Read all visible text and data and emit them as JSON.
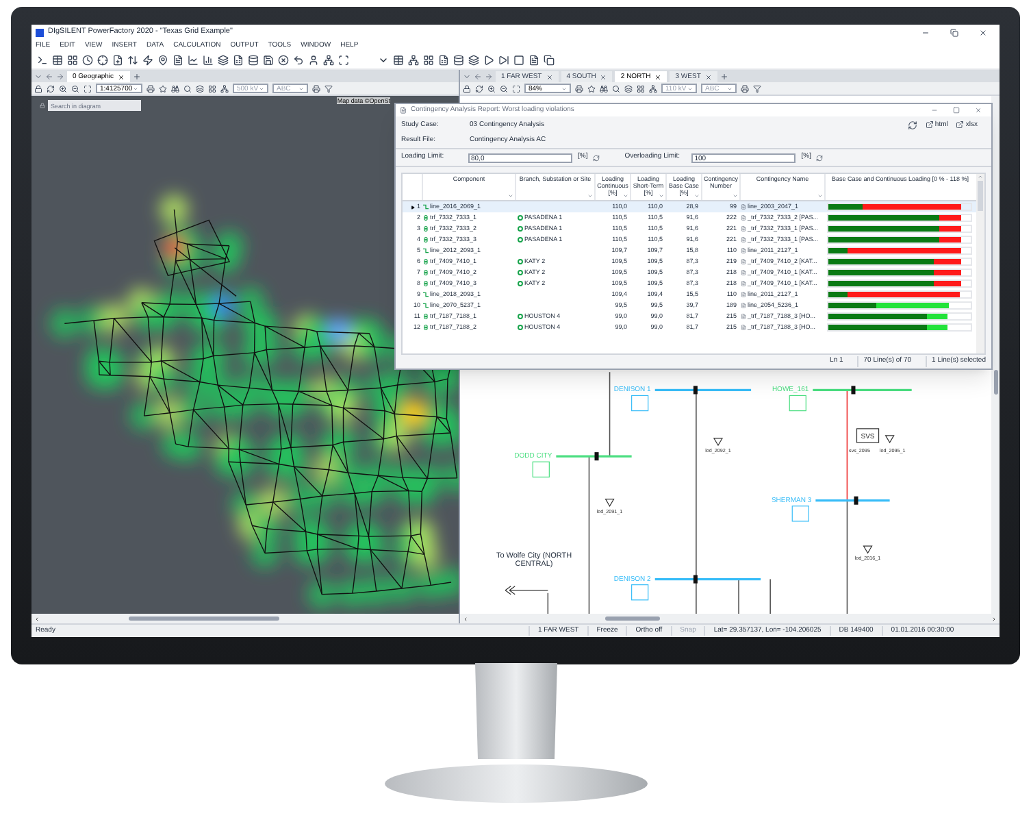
{
  "window": {
    "title": "DIgSILENT PowerFactory 2020 - \"Texas Grid Example\""
  },
  "menu": [
    "FILE",
    "EDIT",
    "VIEW",
    "INSERT",
    "DATA",
    "CALCULATION",
    "OUTPUT",
    "TOOLS",
    "WINDOW",
    "HELP"
  ],
  "left_pane": {
    "tabs": [
      {
        "label": "0 Geographic",
        "selected": true
      }
    ],
    "zoom": "1:4125700",
    "voltage": "500 kV",
    "label_filter": "ABC",
    "search": {
      "placeholder": "Search in diagram"
    },
    "attribution": "Map data ©OpenSt"
  },
  "right_pane": {
    "tabs": [
      {
        "label": "1 FAR WEST",
        "selected": false
      },
      {
        "label": "4 SOUTH",
        "selected": false
      },
      {
        "label": "2 NORTH",
        "selected": true
      },
      {
        "label": "3 WEST",
        "selected": false
      }
    ],
    "zoom": "84%",
    "voltage": "110 kV",
    "label_filter": "ABC",
    "diagram": {
      "buses": [
        {
          "name": "DENISON 1",
          "color": "#38bdf8"
        },
        {
          "name": "HOWE_161",
          "color": "#4ade80"
        },
        {
          "name": "DODD CITY",
          "color": "#4ade80"
        },
        {
          "name": "SHERMAN 3",
          "color": "#38bdf8"
        },
        {
          "name": "DENISON 2",
          "color": "#38bdf8"
        }
      ],
      "loads": [
        "lod_2092_1",
        "lod_2091_1",
        "svs_2095",
        "lod_2095_1",
        "lod_2016_1"
      ],
      "svs_symbol": "SVS",
      "remote_link": "To Wolfe City (NORTH CENTRAL)"
    }
  },
  "report": {
    "title": "Contingency Analysis Report: Worst loading violations",
    "study_case_label": "Study Case:",
    "study_case": "03 Contingency Analysis",
    "result_file_label": "Result File:",
    "result_file": "Contingency Analysis AC",
    "export_buttons": [
      "html",
      "xlsx"
    ],
    "loading_limit": {
      "label": "Loading Limit:",
      "value": "80,0",
      "unit": "[%]"
    },
    "overloading_limit": {
      "label": "Overloading Limit:",
      "value": "100",
      "unit": "[%]"
    },
    "columns": [
      "Component",
      "Branch, Substation or Site",
      "Loading Continuous [%]",
      "Loading Short-Term [%]",
      "Loading Base Case [%]",
      "Contingency Number",
      "Contingency Name",
      "Base Case and Continuous Loading [0 % - 118 %]"
    ],
    "rows": [
      {
        "number": "1",
        "kind": "line",
        "component": "line_2016_2069_1",
        "loading_continuous": "110,0",
        "loading_short_term": "110,0",
        "loading_base_case": "28,9",
        "contingency_number": "99",
        "contingency_name": "line_2003_2047_1",
        "selected": true,
        "base_bar": {
          "level": 0.245
        },
        "loading_bar": {
          "level": 0.932,
          "overloaded": true
        }
      },
      {
        "number": "2",
        "kind": "transformer",
        "component": "trf_7332_7333_1",
        "site": "PASADENA 1",
        "loading_continuous": "110,5",
        "loading_short_term": "110,5",
        "loading_base_case": "91,6",
        "contingency_number": "222",
        "contingency_name": "_trf_7332_7333_2 [PAS...",
        "selected": false,
        "base_bar": {
          "level": 0.776
        },
        "loading_bar": {
          "level": 0.936,
          "overloaded": true
        }
      },
      {
        "number": "3",
        "kind": "transformer",
        "component": "trf_7332_7333_2",
        "site": "PASADENA 1",
        "loading_continuous": "110,5",
        "loading_short_term": "110,5",
        "loading_base_case": "91,6",
        "contingency_number": "221",
        "contingency_name": "_trf_7332_7333_1 [PAS...",
        "selected": false,
        "base_bar": {
          "level": 0.776
        },
        "loading_bar": {
          "level": 0.936,
          "overloaded": true
        }
      },
      {
        "number": "4",
        "kind": "transformer",
        "component": "trf_7332_7333_3",
        "site": "PASADENA 1",
        "loading_continuous": "110,5",
        "loading_short_term": "110,5",
        "loading_base_case": "91,6",
        "contingency_number": "221",
        "contingency_name": "_trf_7332_7333_1 [PAS...",
        "selected": false,
        "base_bar": {
          "level": 0.776
        },
        "loading_bar": {
          "level": 0.936,
          "overloaded": true
        }
      },
      {
        "number": "5",
        "kind": "line",
        "component": "line_2012_2093_1",
        "loading_continuous": "109,7",
        "loading_short_term": "109,7",
        "loading_base_case": "15,8",
        "contingency_number": "110",
        "contingency_name": "line_2011_2127_1",
        "selected": false,
        "base_bar": {
          "level": 0.134
        },
        "loading_bar": {
          "level": 0.93,
          "overloaded": true
        }
      },
      {
        "number": "6",
        "kind": "transformer",
        "component": "trf_7409_7410_1",
        "site": "KATY 2",
        "loading_continuous": "109,5",
        "loading_short_term": "109,5",
        "loading_base_case": "87,3",
        "contingency_number": "219",
        "contingency_name": "_trf_7409_7410_2 [KAT...",
        "selected": false,
        "base_bar": {
          "level": 0.74
        },
        "loading_bar": {
          "level": 0.928,
          "overloaded": true
        }
      },
      {
        "number": "7",
        "kind": "transformer",
        "component": "trf_7409_7410_2",
        "site": "KATY 2",
        "loading_continuous": "109,5",
        "loading_short_term": "109,5",
        "loading_base_case": "87,3",
        "contingency_number": "218",
        "contingency_name": "_trf_7409_7410_1 [KAT...",
        "selected": false,
        "base_bar": {
          "level": 0.74
        },
        "loading_bar": {
          "level": 0.928,
          "overloaded": true
        }
      },
      {
        "number": "8",
        "kind": "transformer",
        "component": "trf_7409_7410_3",
        "site": "KATY 2",
        "loading_continuous": "109,5",
        "loading_short_term": "109,5",
        "loading_base_case": "87,3",
        "contingency_number": "218",
        "contingency_name": "_trf_7409_7410_1 [KAT...",
        "selected": false,
        "base_bar": {
          "level": 0.74
        },
        "loading_bar": {
          "level": 0.928,
          "overloaded": true
        }
      },
      {
        "number": "9",
        "kind": "line",
        "component": "line_2018_2093_1",
        "loading_continuous": "109,4",
        "loading_short_term": "109,4",
        "loading_base_case": "15,5",
        "contingency_number": "110",
        "contingency_name": "line_2011_2127_1",
        "selected": false,
        "base_bar": {
          "level": 0.131
        },
        "loading_bar": {
          "level": 0.927,
          "overloaded": true
        }
      },
      {
        "number": "10",
        "kind": "line",
        "component": "line_2070_5237_1",
        "loading_continuous": "99,5",
        "loading_short_term": "99,5",
        "loading_base_case": "39,7",
        "contingency_number": "189",
        "contingency_name": "line_2054_5236_1",
        "selected": false,
        "base_bar": {
          "level": 0.336
        },
        "loading_bar": {
          "level": 0.843,
          "overloaded": false
        }
      },
      {
        "number": "11",
        "kind": "transformer",
        "component": "trf_7187_7188_1",
        "site": "HOUSTON 4",
        "loading_continuous": "99,0",
        "loading_short_term": "99,0",
        "loading_base_case": "81,7",
        "contingency_number": "215",
        "contingency_name": "_trf_7187_7188_3 [HO...",
        "selected": false,
        "base_bar": {
          "level": 0.692
        },
        "loading_bar": {
          "level": 0.839,
          "overloaded": false
        }
      },
      {
        "number": "12",
        "kind": "transformer",
        "component": "trf_7187_7188_2",
        "site": "HOUSTON 4",
        "loading_continuous": "99,0",
        "loading_short_term": "99,0",
        "loading_base_case": "81,7",
        "contingency_number": "215",
        "contingency_name": "_trf_7187_7188_3 [HO...",
        "selected": false,
        "base_bar": {
          "level": 0.692
        },
        "loading_bar": {
          "level": 0.839,
          "overloaded": false
        }
      }
    ],
    "status": {
      "line": "Ln 1",
      "count": "70 Line(s) of 70",
      "selected": "1 Line(s) selected"
    }
  },
  "status_bar": [
    {
      "text": "Ready",
      "disabled": false
    },
    {
      "text": "1 FAR WEST",
      "disabled": false
    },
    {
      "text": "Freeze",
      "disabled": false
    },
    {
      "text": "Ortho off",
      "disabled": false
    },
    {
      "text": "Snap",
      "disabled": true
    },
    {
      "text": "Lat= 29.357137, Lon= -104.206025",
      "disabled": false
    },
    {
      "text": "DB 149400",
      "disabled": false
    },
    {
      "text": "01.01.2016 00:30:00",
      "disabled": false
    }
  ]
}
